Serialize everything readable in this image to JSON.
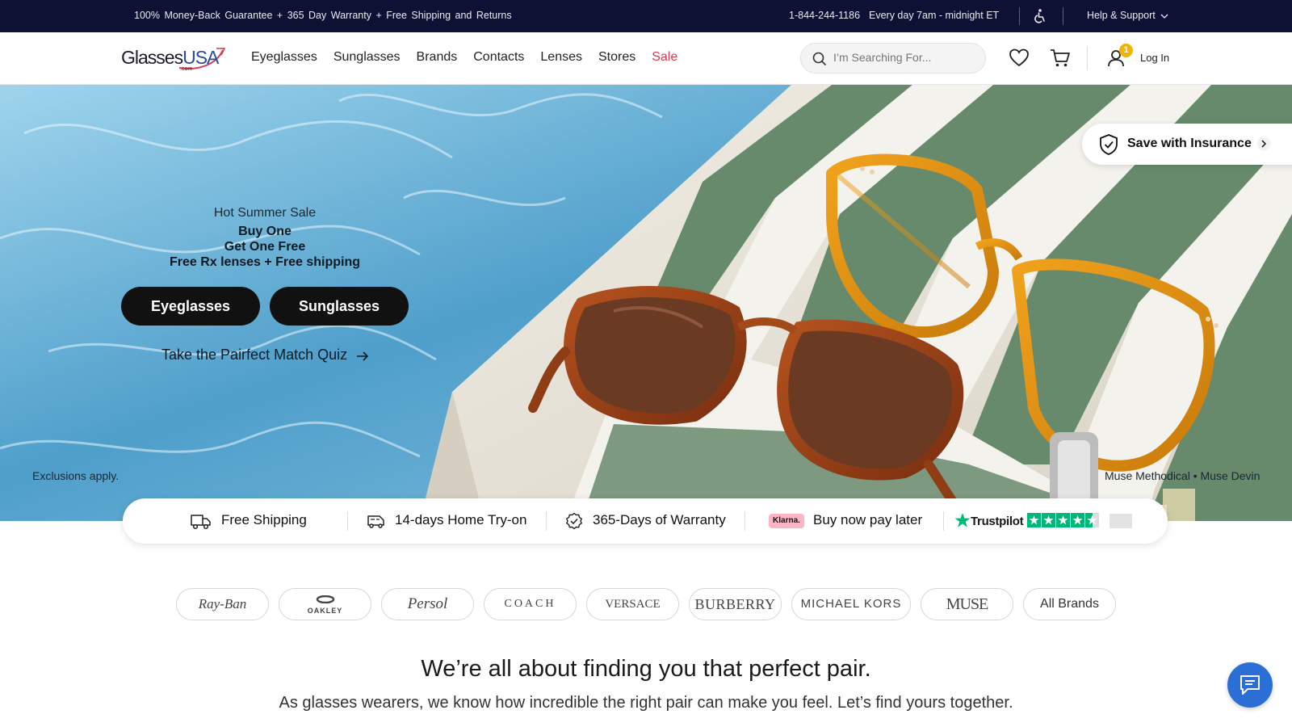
{
  "topbar": {
    "promo": "100% Money-Back Guarantee + 365 Day Warranty + Free Shipping and Returns",
    "phone": "1-844-244-1186",
    "hours": "Every day 7am - midnight ET",
    "help": "Help & Support"
  },
  "header": {
    "logo_word_a": "Glasses",
    "logo_word_b": "USA",
    "logo_suffix": ".com",
    "nav": [
      "Eyeglasses",
      "Sunglasses",
      "Brands",
      "Contacts",
      "Lenses",
      "Stores",
      "Sale"
    ],
    "search_placeholder": "I’m Searching For...",
    "cart_count": "1",
    "login": "Log In"
  },
  "hero": {
    "kicker": "Hot Summer Sale",
    "line1": "Buy One",
    "line2": "Get One Free",
    "line3": "Free Rx lenses + Free shipping",
    "btn_eyeglasses": "Eyeglasses",
    "btn_sunglasses": "Sunglasses",
    "quiz": "Take the Pairfect Match Quiz",
    "exclusions": "Exclusions apply.",
    "credits": "Muse Methodical • Muse Devin",
    "insurance": "Save with Insurance"
  },
  "props": {
    "shipping": "Free Shipping",
    "tryon": "14-days Home Try-on",
    "warranty": "365-Days of Warranty",
    "klarna_badge": "Klarna.",
    "bnpl": "Buy now pay later",
    "trustpilot": "Trustpilot"
  },
  "brands": [
    "Ray-Ban",
    "OAKLEY",
    "Persol",
    "COACH",
    "VERSACE",
    "BURBERRY",
    "MICHAEL KORS",
    "MUSE",
    "All Brands"
  ],
  "intro": {
    "headline": "We’re all about finding you that perfect pair.",
    "subline": "As glasses wearers, we know how incredible the right pair can make you feel. Let’s find yours together."
  },
  "colors": {
    "topbar_bg": "#0d1235",
    "sale": "#d33a4e",
    "badge": "#f5b301",
    "chat": "#2b6fd6",
    "trustpilot_green": "#00b67a",
    "klarna_pink": "#ffb3c7"
  },
  "icons": [
    "accessibility-icon",
    "chevron-down-icon",
    "search-icon",
    "heart-icon",
    "cart-icon",
    "user-icon",
    "shield-icon",
    "chevron-right-icon",
    "arrow-right-icon",
    "truck-icon",
    "van-icon",
    "badge-check-icon",
    "trustpilot-star-icon",
    "chat-icon"
  ]
}
